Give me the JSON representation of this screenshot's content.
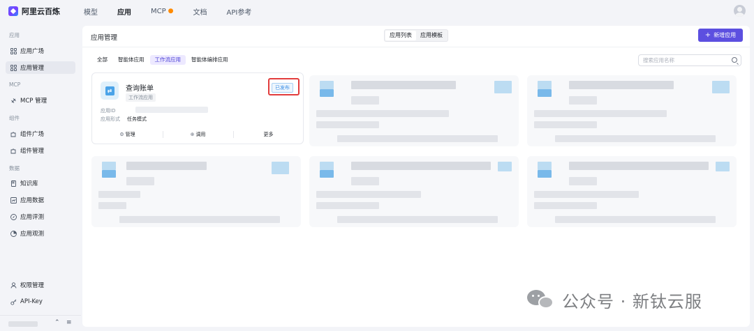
{
  "brand": {
    "name": "阿里云百炼"
  },
  "nav": {
    "items": [
      {
        "label": "模型"
      },
      {
        "label": "应用"
      },
      {
        "label": "MCP"
      },
      {
        "label": "文档"
      },
      {
        "label": "API参考"
      }
    ]
  },
  "sidebar": {
    "sections": [
      "应用",
      "MCP",
      "组件",
      "数据"
    ],
    "items": [
      {
        "label": "应用广场",
        "icon": "grid-icon"
      },
      {
        "label": "应用管理",
        "icon": "grid-icon"
      },
      {
        "label": "MCP 管理",
        "icon": "plug-icon"
      },
      {
        "label": "组件广场",
        "icon": "puzzle-icon"
      },
      {
        "label": "组件管理",
        "icon": "puzzle-icon"
      },
      {
        "label": "知识库",
        "icon": "book-icon"
      },
      {
        "label": "应用数据",
        "icon": "chart-icon"
      },
      {
        "label": "应用评测",
        "icon": "compass-icon"
      },
      {
        "label": "应用观测",
        "icon": "pie-icon"
      },
      {
        "label": "权限管理",
        "icon": "user-icon"
      },
      {
        "label": "API-Key",
        "icon": "key-icon"
      }
    ]
  },
  "main": {
    "title": "应用管理",
    "segments": [
      "应用列表",
      "应用模板"
    ],
    "new_button": "新增应用",
    "tabs": [
      "全部",
      "智能体应用",
      "工作流应用",
      "智能体编排应用"
    ],
    "search_placeholder": "搜索应用名称"
  },
  "card": {
    "name": "查询账单",
    "tag": "工作流应用",
    "status": "已发布",
    "meta_id_label": "应用ID",
    "meta_mode_label": "应用形式",
    "meta_mode_value": "任务模式",
    "actions": [
      "管理",
      "调用",
      "更多"
    ]
  },
  "watermark": {
    "text": "公众号 · 新钛云服"
  },
  "colors": {
    "accent": "#5c4fe0",
    "badge": "#3a8ee6",
    "highlight": "#e23c3c"
  }
}
